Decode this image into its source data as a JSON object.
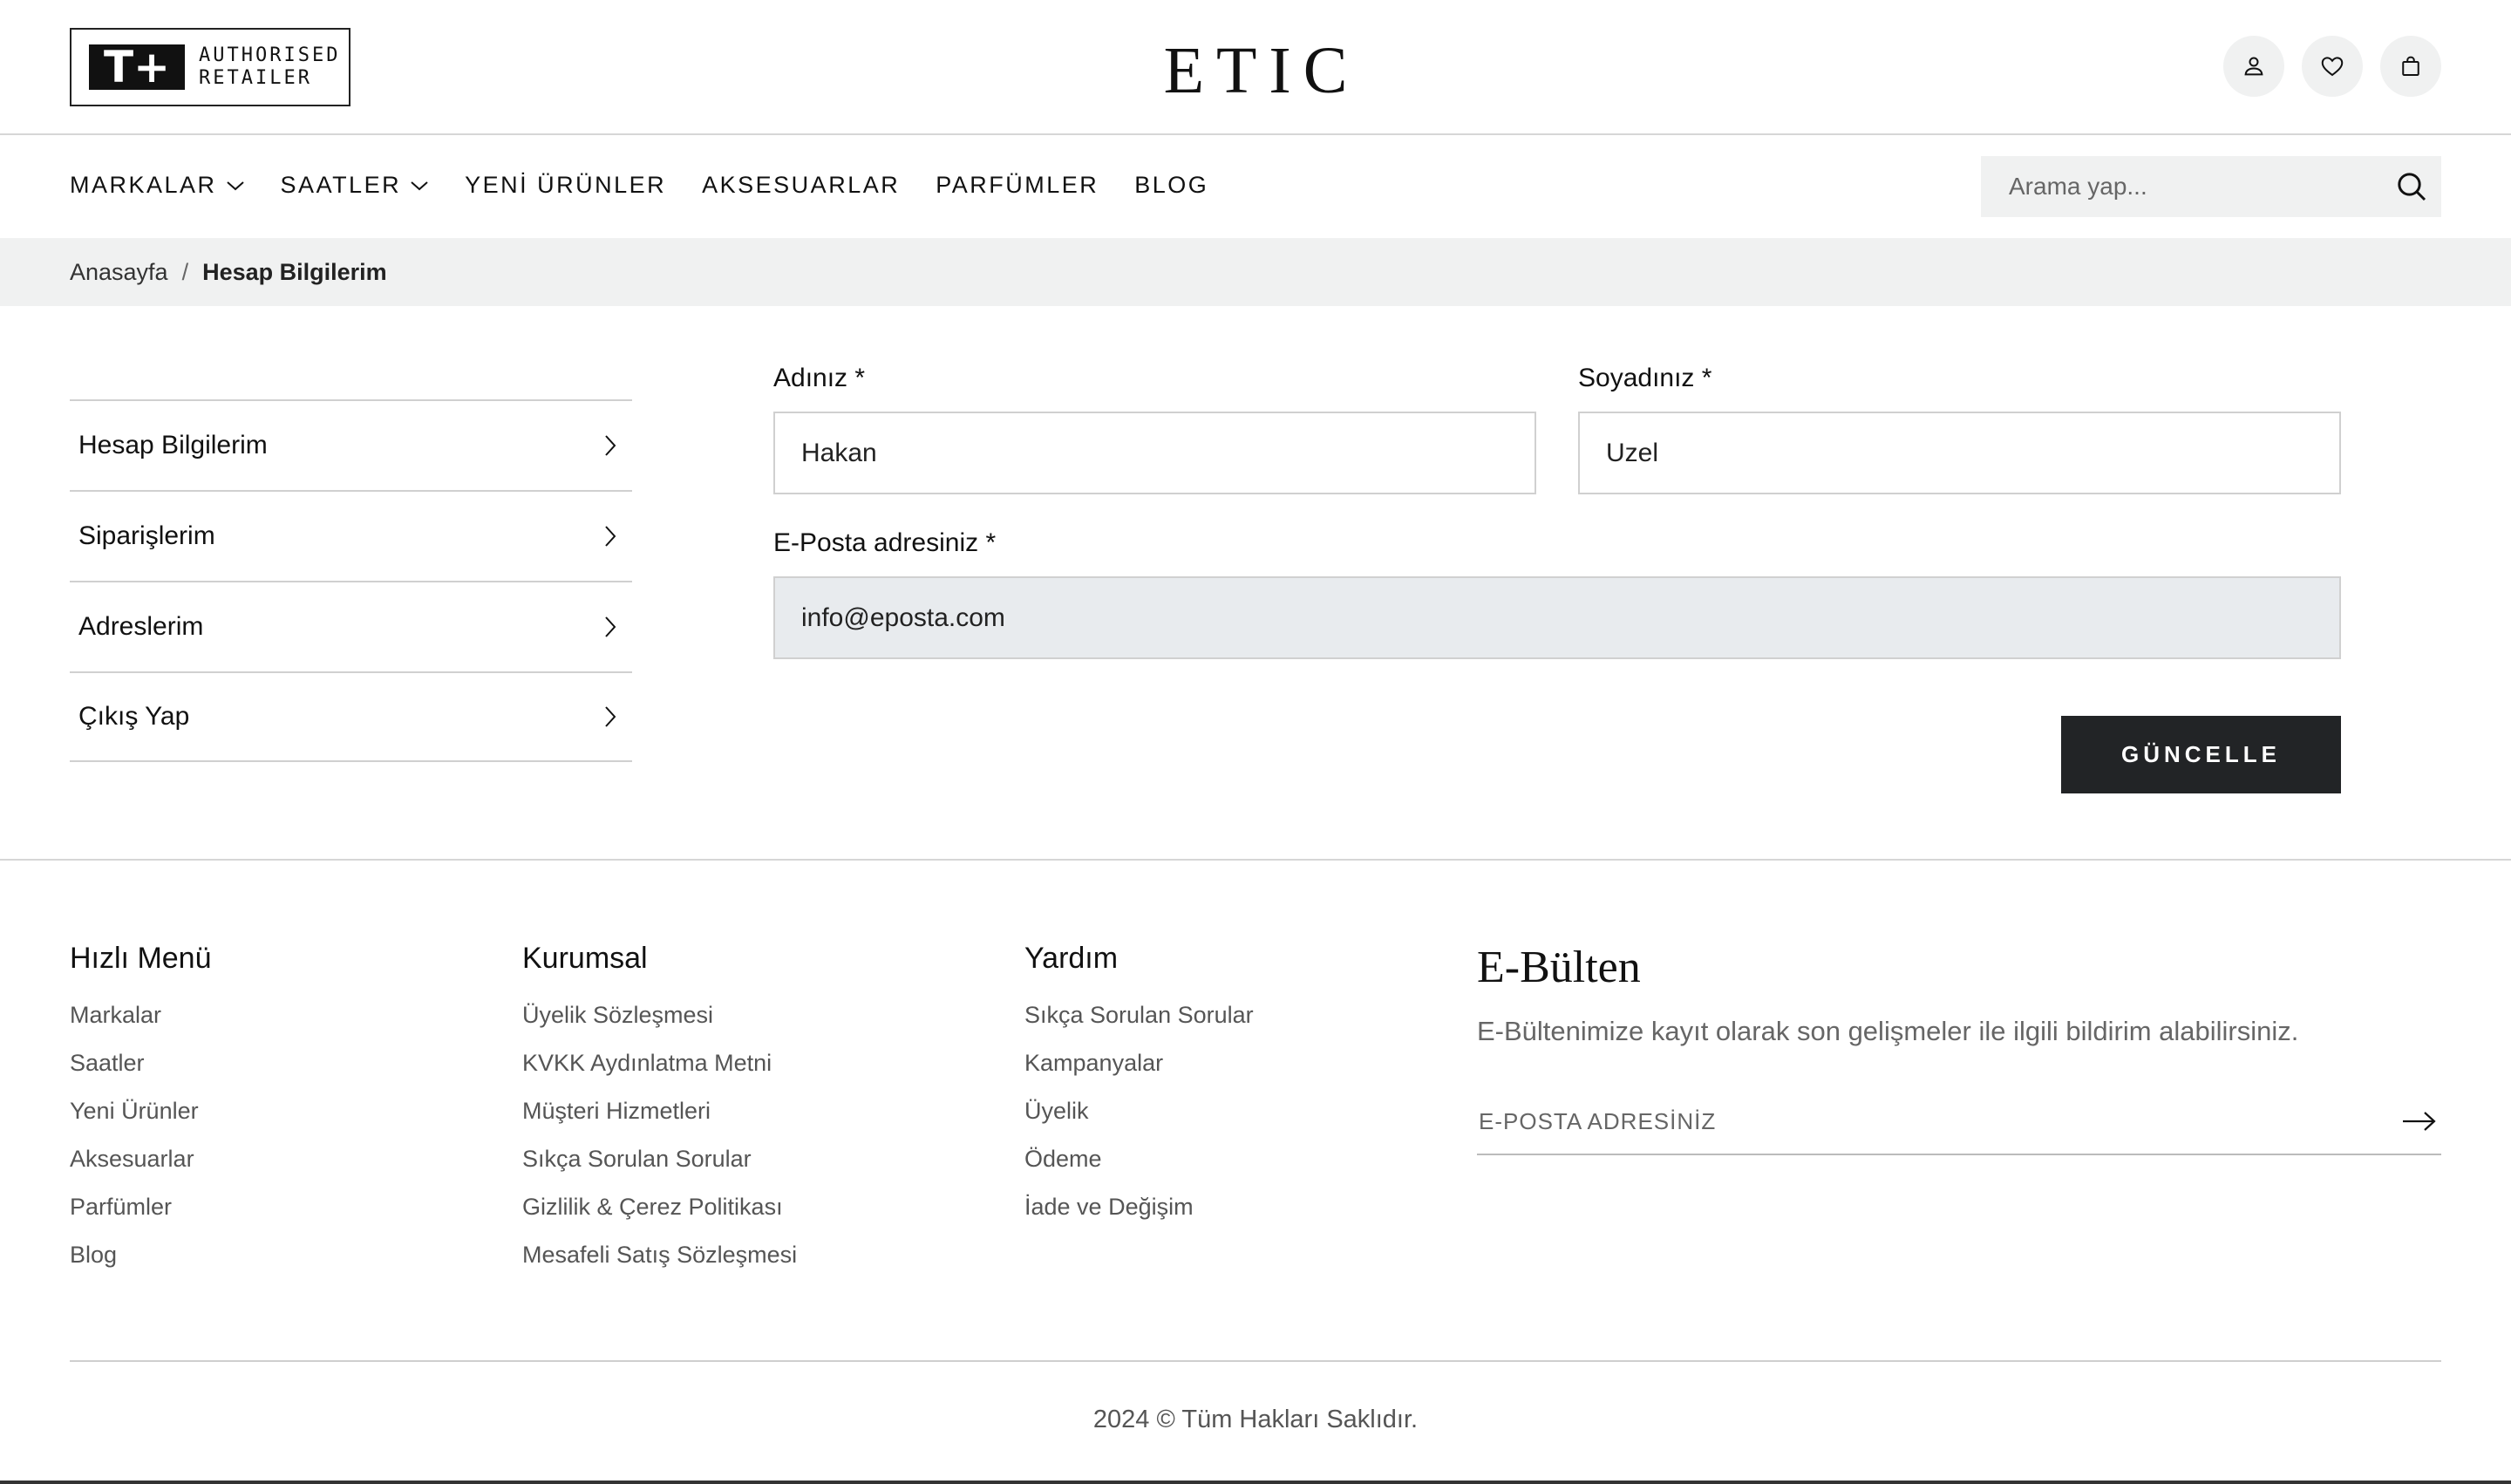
{
  "header": {
    "retailer_badge": {
      "mark": "T+",
      "line1": "AUTHORISED",
      "line2": "RETAILER"
    },
    "brand": "ETIC",
    "icons": [
      "user-icon",
      "heart-icon",
      "shopping-bag-icon"
    ]
  },
  "nav": {
    "items": [
      {
        "label": "MARKALAR",
        "has_dropdown": true
      },
      {
        "label": "SAATLER",
        "has_dropdown": true
      },
      {
        "label": "YENİ ÜRÜNLER",
        "has_dropdown": false
      },
      {
        "label": "AKSESUARLAR",
        "has_dropdown": false
      },
      {
        "label": "PARFÜMLER",
        "has_dropdown": false
      },
      {
        "label": "BLOG",
        "has_dropdown": false
      }
    ],
    "search_placeholder": "Arama yap..."
  },
  "breadcrumb": {
    "home": "Anasayfa",
    "separator": "/",
    "current": "Hesap Bilgilerim"
  },
  "sidebar": {
    "items": [
      {
        "label": "Hesap Bilgilerim",
        "active": true
      },
      {
        "label": "Siparişlerim",
        "active": false
      },
      {
        "label": "Adreslerim",
        "active": false
      },
      {
        "label": "Çıkış Yap",
        "active": false
      }
    ]
  },
  "form": {
    "first_name": {
      "label": "Adınız *",
      "value": "Hakan"
    },
    "last_name": {
      "label": "Soyadınız *",
      "value": "Uzel"
    },
    "email": {
      "label": "E-Posta adresiniz *",
      "value": "info@eposta.com",
      "disabled": true
    },
    "submit_label": "GÜNCELLE"
  },
  "footer": {
    "quick_menu": {
      "title": "Hızlı Menü",
      "links": [
        "Markalar",
        "Saatler",
        "Yeni Ürünler",
        "Aksesuarlar",
        "Parfümler",
        "Blog"
      ]
    },
    "corporate": {
      "title": "Kurumsal",
      "links": [
        "Üyelik Sözleşmesi",
        "KVKK Aydınlatma Metni",
        "Müşteri Hizmetleri",
        "Sıkça Sorulan Sorular",
        "Gizlilik & Çerez Politikası",
        "Mesafeli Satış Sözleşmesi"
      ]
    },
    "help": {
      "title": "Yardım",
      "links": [
        "Sıkça Sorulan Sorular",
        "Kampanyalar",
        "Üyelik",
        "Ödeme",
        "İade ve Değişim"
      ]
    },
    "newsletter": {
      "title": "E-Bülten",
      "description": "E-Bültenimize kayıt olarak son gelişmeler ile ilgili bildirim alabilirsiniz.",
      "placeholder": "E-POSTA ADRESİNİZ"
    },
    "copyright": "2024 © Tüm Hakları Saklıdır."
  },
  "colors": {
    "dark_button": "#222426",
    "light_gray_bg": "#f0f1f1",
    "disabled_field_bg": "#e8ebee"
  }
}
